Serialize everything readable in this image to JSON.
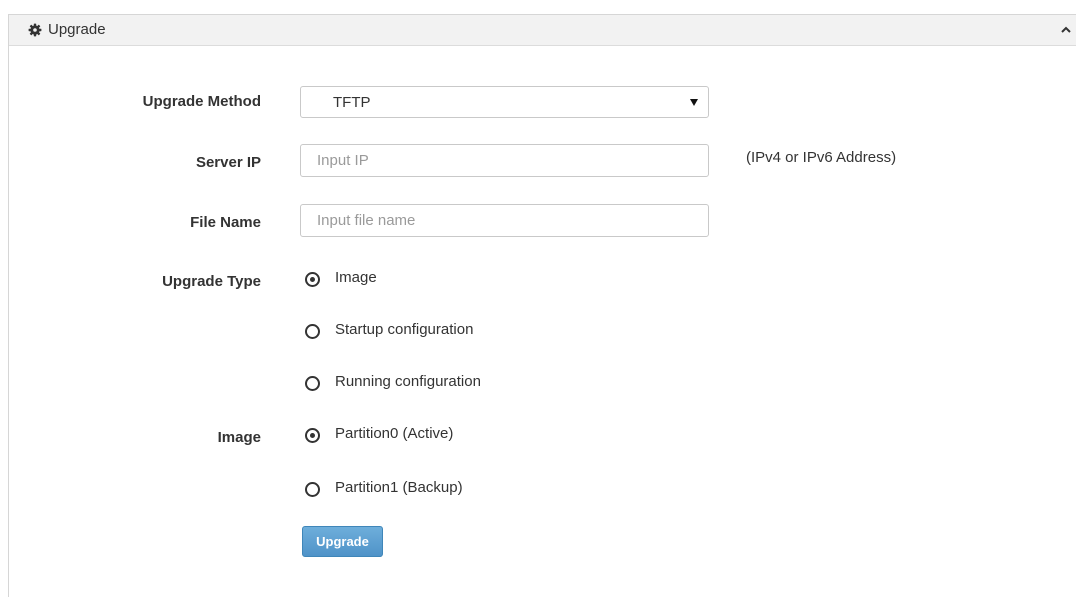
{
  "panel": {
    "title": "Upgrade",
    "title_icon": "gear-icon",
    "collapse_icon": "chevron-up-icon"
  },
  "form": {
    "upgrade_method": {
      "label": "Upgrade Method",
      "value": "TFTP"
    },
    "server_ip": {
      "label": "Server IP",
      "value": "",
      "placeholder": "Input IP",
      "hint": "(IPv4 or IPv6 Address)"
    },
    "file_name": {
      "label": "File Name",
      "value": "",
      "placeholder": "Input file name"
    },
    "upgrade_type": {
      "label": "Upgrade Type",
      "options": [
        {
          "label": "Image",
          "selected": true
        },
        {
          "label": "Startup configuration",
          "selected": false
        },
        {
          "label": "Running configuration",
          "selected": false
        }
      ]
    },
    "image": {
      "label": "Image",
      "options": [
        {
          "label": "Partition0 (Active)",
          "selected": true
        },
        {
          "label": "Partition1 (Backup)",
          "selected": false
        }
      ]
    },
    "submit_label": "Upgrade"
  },
  "colors": {
    "button": "#5a9fd4",
    "header_background": "#f2f2f2"
  }
}
